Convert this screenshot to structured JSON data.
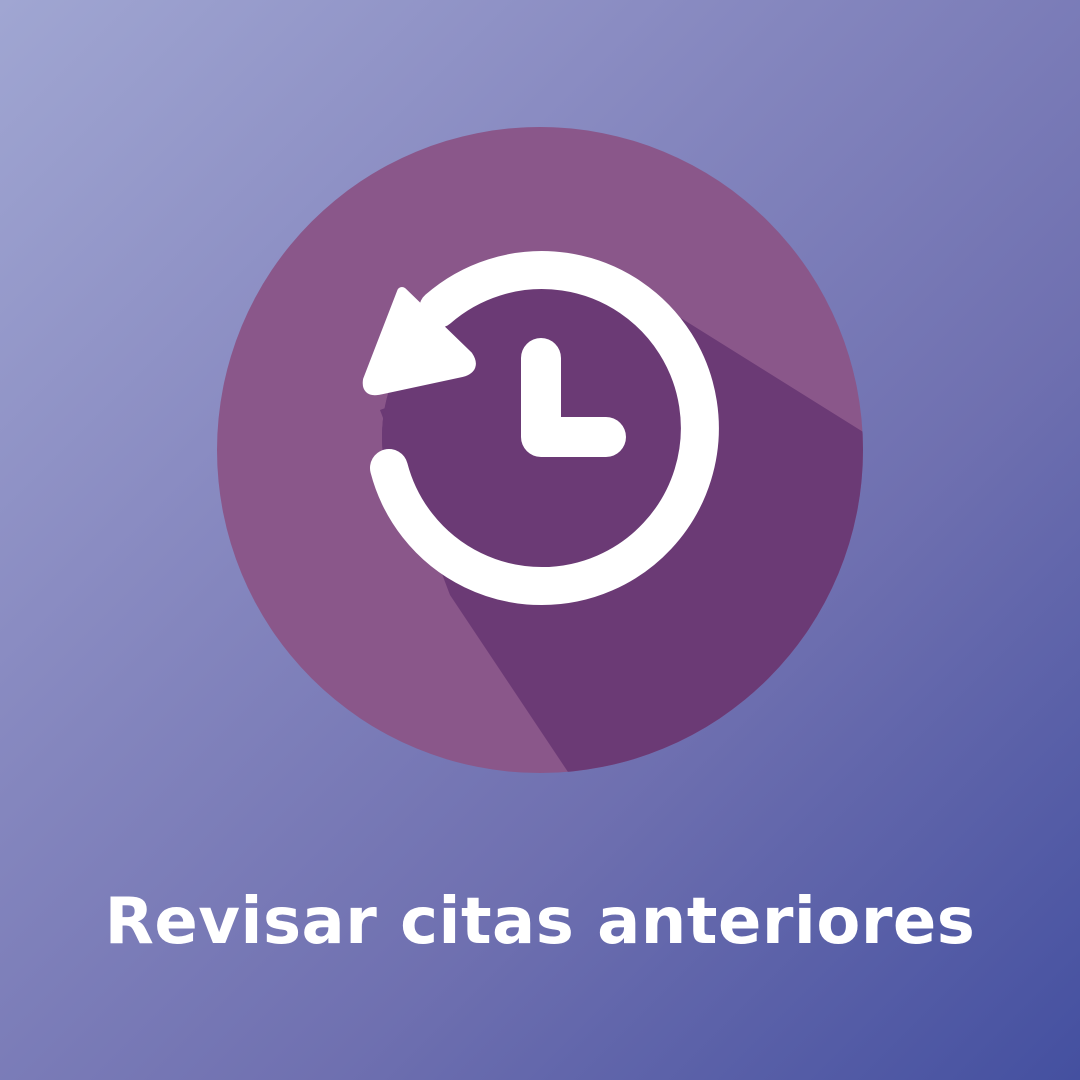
{
  "tile": {
    "label": "Revisar citas anteriores",
    "icon": "history-clock-icon"
  },
  "colors": {
    "background_top_left": "#a0a6d2",
    "background_bottom_right": "#4450a0",
    "circle": "#8a578a",
    "long_shadow": "#6b3a75",
    "icon_fill": "#ffffff",
    "label_text": "#ffffff"
  }
}
